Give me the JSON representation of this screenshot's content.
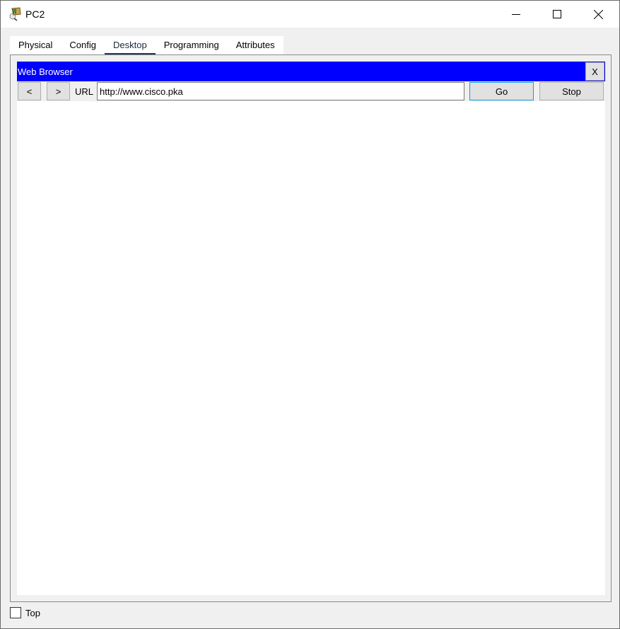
{
  "window": {
    "title": "PC2",
    "icon": "packet-tracer-pc-icon",
    "controls": {
      "minimize": "minimize-icon",
      "maximize": "maximize-icon",
      "close": "close-icon"
    }
  },
  "tabs": [
    {
      "label": "Physical",
      "active": false
    },
    {
      "label": "Config",
      "active": false
    },
    {
      "label": "Desktop",
      "active": true
    },
    {
      "label": "Programming",
      "active": false
    },
    {
      "label": "Attributes",
      "active": false
    }
  ],
  "browser": {
    "title": "Web Browser",
    "close_label": "X",
    "back_label": "<",
    "forward_label": ">",
    "url_label": "URL",
    "url_value": "http://www.cisco.pka",
    "go_label": "Go",
    "stop_label": "Stop",
    "header_color": "#0000ff"
  },
  "footer": {
    "top_label": "Top",
    "top_checked": false
  }
}
